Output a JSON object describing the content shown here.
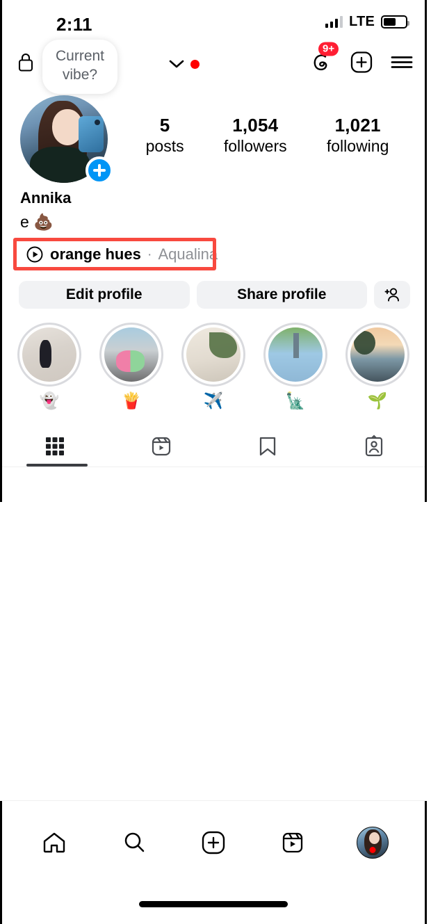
{
  "status_bar": {
    "time": "2:11",
    "network_type": "LTE",
    "signal_icon": "signal-bars-icon",
    "signal_bars_filled": 3,
    "signal_bars_total": 4,
    "battery_icon": "battery-icon",
    "battery_percent": 55
  },
  "top_nav": {
    "lock_icon": "lock-icon",
    "account_switcher_icon": "chevron-down-icon",
    "account_switcher_dot": "red-dot-indicator",
    "threads_icon": "threads-icon",
    "threads_badge": "9+",
    "create_icon": "plus-square-icon",
    "menu_icon": "hamburger-menu-icon"
  },
  "profile": {
    "note": "Current vibe?",
    "avatar_icon": "profile-avatar",
    "add_story_icon": "plus-icon",
    "stats": [
      {
        "num": "5",
        "label": "posts"
      },
      {
        "num": "1,054",
        "label": "followers"
      },
      {
        "num": "1,021",
        "label": "following"
      }
    ],
    "display_name": "Annika",
    "bio": "e 💩",
    "music": {
      "play_icon": "play-circle-icon",
      "track": "orange hues",
      "separator": "·",
      "artist": "Aqualina",
      "highlight_color": "#f8493f"
    }
  },
  "actions": {
    "edit_profile": "Edit profile",
    "share_profile": "Share profile",
    "add_person_icon": "add-person-icon"
  },
  "highlights": [
    {
      "emoji": "👻",
      "name": "highlight-ghost"
    },
    {
      "emoji": "🍟",
      "name": "highlight-fries"
    },
    {
      "emoji": "✈️",
      "name": "highlight-airplane"
    },
    {
      "emoji": "🗽",
      "name": "highlight-statue-of-liberty"
    },
    {
      "emoji": "🌱",
      "name": "highlight-seedling"
    }
  ],
  "tabs": [
    {
      "icon": "grid-icon",
      "name": "tab-posts",
      "active": true
    },
    {
      "icon": "reels-icon",
      "name": "tab-reels",
      "active": false
    },
    {
      "icon": "bookmark-icon",
      "name": "tab-saved",
      "active": false
    },
    {
      "icon": "tagged-icon",
      "name": "tab-tagged",
      "active": false
    }
  ],
  "bottom_nav": [
    {
      "icon": "home-icon",
      "name": "nav-home"
    },
    {
      "icon": "search-icon",
      "name": "nav-search"
    },
    {
      "icon": "plus-square-icon",
      "name": "nav-create"
    },
    {
      "icon": "reels-icon",
      "name": "nav-reels"
    },
    {
      "icon": "profile-avatar-icon",
      "name": "nav-profile"
    }
  ]
}
